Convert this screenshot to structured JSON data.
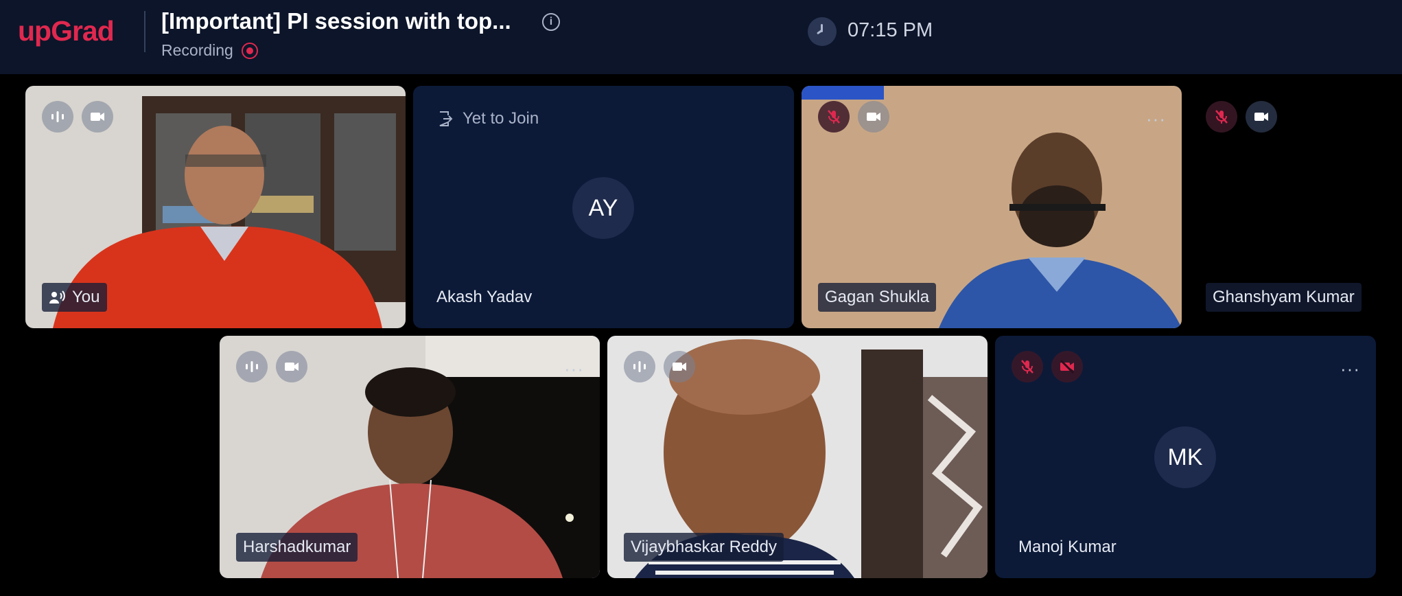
{
  "app": {
    "logo": "upGrad",
    "title": "[Important] PI session with top...",
    "recording_label": "Recording",
    "time": "07:15 PM"
  },
  "participants": [
    {
      "name": "You",
      "avatar": "",
      "status": "",
      "has_more": false
    },
    {
      "name": "Akash Yadav",
      "avatar": "AY",
      "status": "Yet to Join",
      "has_more": false
    },
    {
      "name": "Gagan Shukla",
      "avatar": "",
      "status": "",
      "has_more": true
    },
    {
      "name": "Ghanshyam Kumar",
      "avatar": "",
      "status": "",
      "has_more": false
    },
    {
      "name": "Harshadkumar",
      "avatar": "",
      "status": "",
      "has_more": true
    },
    {
      "name": "Vijaybhaskar Reddy",
      "avatar": "",
      "status": "",
      "has_more": false
    },
    {
      "name": "Manoj Kumar",
      "avatar": "MK",
      "status": "",
      "has_more": true
    }
  ],
  "more_glyph": "···",
  "info_glyph": "i",
  "colors": {
    "accent": "#e0284f",
    "header_bg": "#0c1529",
    "tile_bg": "#0c1a38"
  }
}
